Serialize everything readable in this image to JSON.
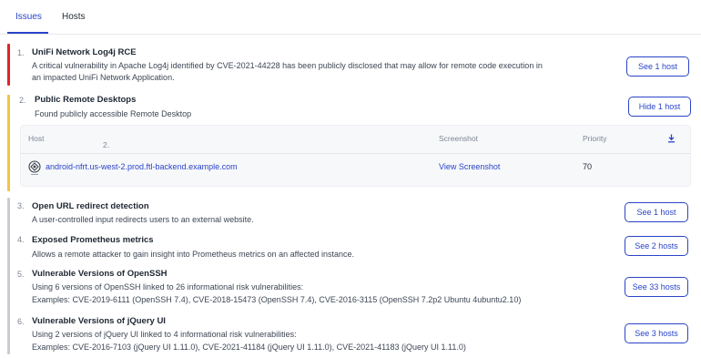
{
  "tabs": [
    {
      "label": "Issues",
      "active": true
    },
    {
      "label": "Hosts",
      "active": false
    }
  ],
  "colors": {
    "accent": "#2a44c8",
    "critical": "#e0242b",
    "medium": "#f3c347",
    "low": "#c9ccd2"
  },
  "issues": [
    {
      "number": "1.",
      "title": "UniFi Network Log4j RCE",
      "description": [
        "A critical vulnerability in Apache Log4j identified by CVE-2021-44228 has been publicly disclosed that may allow for remote code execution in",
        "an impacted UniFi Network Application."
      ],
      "button": "See 1 host"
    },
    {
      "number": "2.",
      "title": "Public Remote Desktops",
      "description": [
        "Found publicly accessible Remote Desktop"
      ],
      "button": "Hide 1 host",
      "hosts_table": {
        "columns": {
          "host": "Host",
          "screenshot": "Screenshot",
          "priority": "Priority"
        },
        "stray_label": "2.",
        "download_icon": "download-icon",
        "rows": [
          {
            "host": "android-nfrt.us-west-2.prod.ftl-backend.example.com",
            "screenshot": "View Screenshot",
            "priority": "70",
            "logo_icon": "host-logo-icon"
          }
        ]
      }
    },
    {
      "number": "3.",
      "title": "Open URL redirect detection",
      "description": [
        "A user-controlled input redirects users to an external website."
      ],
      "button": "See 1 host"
    },
    {
      "number": "4.",
      "title": "Exposed Prometheus metrics",
      "description": [
        "Allows a remote attacker to gain insight into Prometheus metrics on an affected instance."
      ],
      "button": "See 2 hosts"
    },
    {
      "number": "5.",
      "title": "Vulnerable Versions of OpenSSH",
      "description": [
        "Using 6 versions of OpenSSH linked to 26 informational risk vulnerabilities:",
        "Examples: CVE-2019-6111 (OpenSSH 7.4), CVE-2018-15473 (OpenSSH 7.4), CVE-2016-3115 (OpenSSH 7.2p2 Ubuntu 4ubuntu2.10)"
      ],
      "button": "See 33 hosts"
    },
    {
      "number": "6.",
      "title": "Vulnerable Versions of jQuery UI",
      "description": [
        "Using 2 versions of jQuery UI linked to 4 informational risk vulnerabilities:",
        "Examples: CVE-2016-7103 (jQuery UI 1.11.0), CVE-2021-41184 (jQuery UI 1.11.0), CVE-2021-41183 (jQuery UI 1.11.0)"
      ],
      "button": "See 3 hosts"
    }
  ]
}
